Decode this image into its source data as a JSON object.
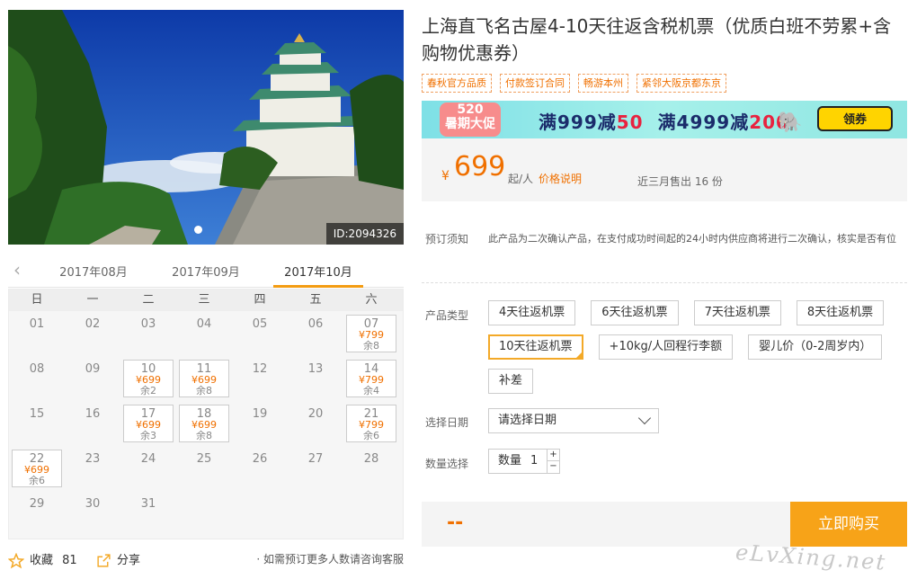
{
  "photo": {
    "id_label": "ID:2094326"
  },
  "calendar": {
    "prev_icon": "chevron-left-icon",
    "months": [
      "2017年08月",
      "2017年09月",
      "2017年10月"
    ],
    "active_month": 2,
    "weekdays": [
      "日",
      "一",
      "二",
      "三",
      "四",
      "五",
      "六"
    ],
    "days": [
      {
        "d": ""
      },
      {
        "d": ""
      },
      {
        "d": ""
      },
      {
        "d": ""
      },
      {
        "d": ""
      },
      {
        "d": ""
      },
      {
        "d": ""
      },
      {
        "d": "01"
      },
      {
        "d": "02"
      },
      {
        "d": "03"
      },
      {
        "d": "04"
      },
      {
        "d": "05"
      },
      {
        "d": "06"
      },
      {
        "d": "07",
        "price": "¥799",
        "rem": "余8"
      },
      {
        "d": "08"
      },
      {
        "d": "09"
      },
      {
        "d": "10",
        "price": "¥699",
        "rem": "余2"
      },
      {
        "d": "11",
        "price": "¥699",
        "rem": "余8"
      },
      {
        "d": "12"
      },
      {
        "d": "13"
      },
      {
        "d": "14",
        "price": "¥799",
        "rem": "余4"
      },
      {
        "d": "15"
      },
      {
        "d": "16"
      },
      {
        "d": "17",
        "price": "¥699",
        "rem": "余3"
      },
      {
        "d": "18",
        "price": "¥699",
        "rem": "余8"
      },
      {
        "d": "19"
      },
      {
        "d": "20"
      },
      {
        "d": "21",
        "price": "¥799",
        "rem": "余6"
      },
      {
        "d": "22",
        "price": "¥699",
        "rem": "余6"
      },
      {
        "d": "23"
      },
      {
        "d": "24"
      },
      {
        "d": "25"
      },
      {
        "d": "26"
      },
      {
        "d": "27"
      },
      {
        "d": "28"
      },
      {
        "d": "29"
      },
      {
        "d": "30"
      },
      {
        "d": "31"
      }
    ]
  },
  "actions": {
    "fav_label": "收藏",
    "fav_count": "81",
    "share_label": "分享",
    "note": "· 如需预订更多人数请咨询客服"
  },
  "product": {
    "title": "上海直飞名古屋4-10天往返含税机票（优质白班不劳累+含购物优惠券）",
    "tags": [
      "春秋官方品质",
      "付款签订合同",
      "畅游本州",
      "紧邻大阪京都东京"
    ],
    "banner": {
      "badge": "520\n暑期大促",
      "promo_a": "满999减",
      "promo_a_num": "50",
      "promo_b": "满4999减",
      "promo_b_num": "200",
      "button": "领券"
    },
    "price": {
      "currency": "¥",
      "amount": "699",
      "unit": "起/人",
      "explain": "价格说明",
      "sold": "近三月售出 16 份"
    },
    "notice_label": "预订须知",
    "notice_text": "此产品为二次确认产品，在支付成功时间起的24小时内供应商将进行二次确认，核实是否有位",
    "type_label": "产品类型",
    "types": [
      "4天往返机票",
      "6天往返机票",
      "7天往返机票",
      "8天往返机票",
      "10天往返机票",
      "+10kg/人回程行李额",
      "婴儿价（0-2周岁内）",
      "补差"
    ],
    "selected_type": 4,
    "date_label": "选择日期",
    "date_placeholder": "请选择日期",
    "qty_label": "数量选择",
    "qty_prefix": "数量",
    "qty_value": "1",
    "total": "--",
    "buy_label": "立即购买"
  },
  "watermark": "eLvXing.net",
  "colors": {
    "accent": "#f07000",
    "buy": "#f7a318",
    "selected_border": "#f3a928"
  }
}
